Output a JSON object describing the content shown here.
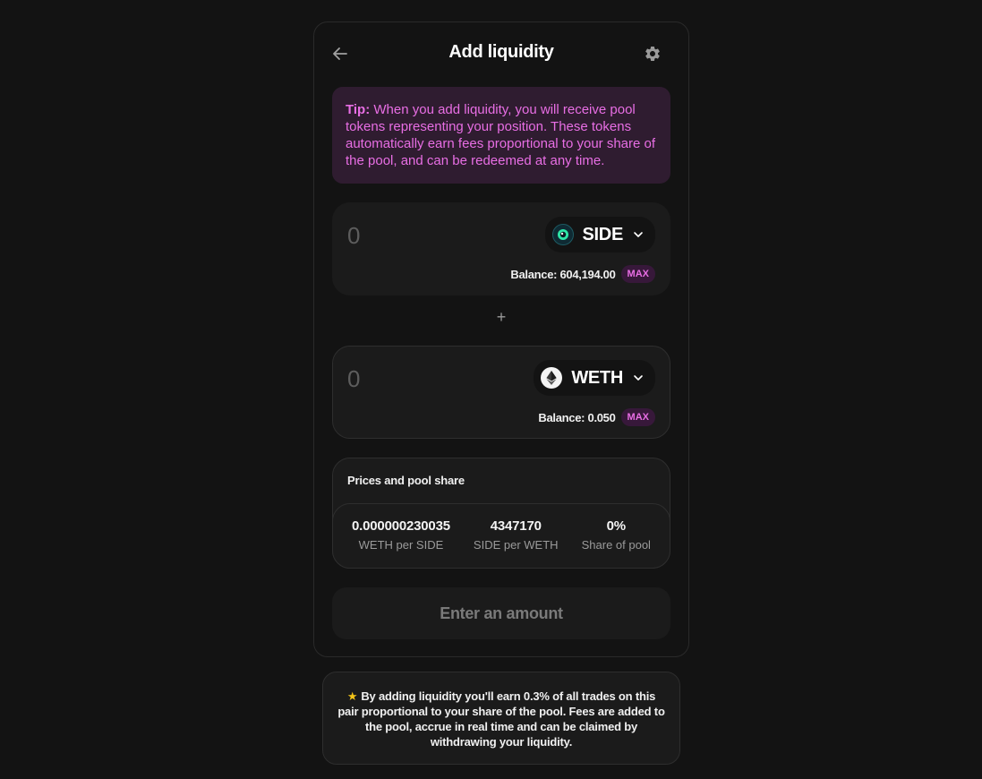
{
  "header": {
    "title": "Add liquidity",
    "back_icon": "arrow-left-icon",
    "settings_icon": "gear-icon"
  },
  "tip": {
    "label": "Tip:",
    "text": " When you add liquidity, you will receive pool tokens representing your position. These tokens automatically earn fees proportional to your share of the pool, and can be redeemed at any time."
  },
  "inputs": [
    {
      "value": "",
      "placeholder": "0",
      "token": "SIDE",
      "token_icon": "side-token-icon",
      "balance": "Balance: 604,194.00",
      "max_label": "MAX"
    },
    {
      "value": "",
      "placeholder": "0",
      "token": "WETH",
      "token_icon": "eth-token-icon",
      "balance": "Balance: 0.050",
      "max_label": "MAX"
    }
  ],
  "plus_symbol": "+",
  "prices": {
    "title": "Prices and pool share",
    "items": [
      {
        "value": "0.000000230035",
        "label": "WETH per SIDE"
      },
      {
        "value": "4347170",
        "label": "SIDE per WETH"
      },
      {
        "value": "0%",
        "label": "Share of pool"
      }
    ]
  },
  "submit": {
    "label": "Enter an amount"
  },
  "info": {
    "icon": "star-icon",
    "star": "★",
    "text": "By adding liquidity you'll earn 0.3% of all trades on this pair proportional to your share of the pool. Fees are added to the pool, accrue in real time and can be claimed by withdrawing your liquidity."
  },
  "colors": {
    "background": "#131313",
    "panel": "#1b1b1b",
    "accent_pink": "#e86ee4",
    "tip_bg": "#2f1c30",
    "side_token": "#2ee6a8"
  }
}
